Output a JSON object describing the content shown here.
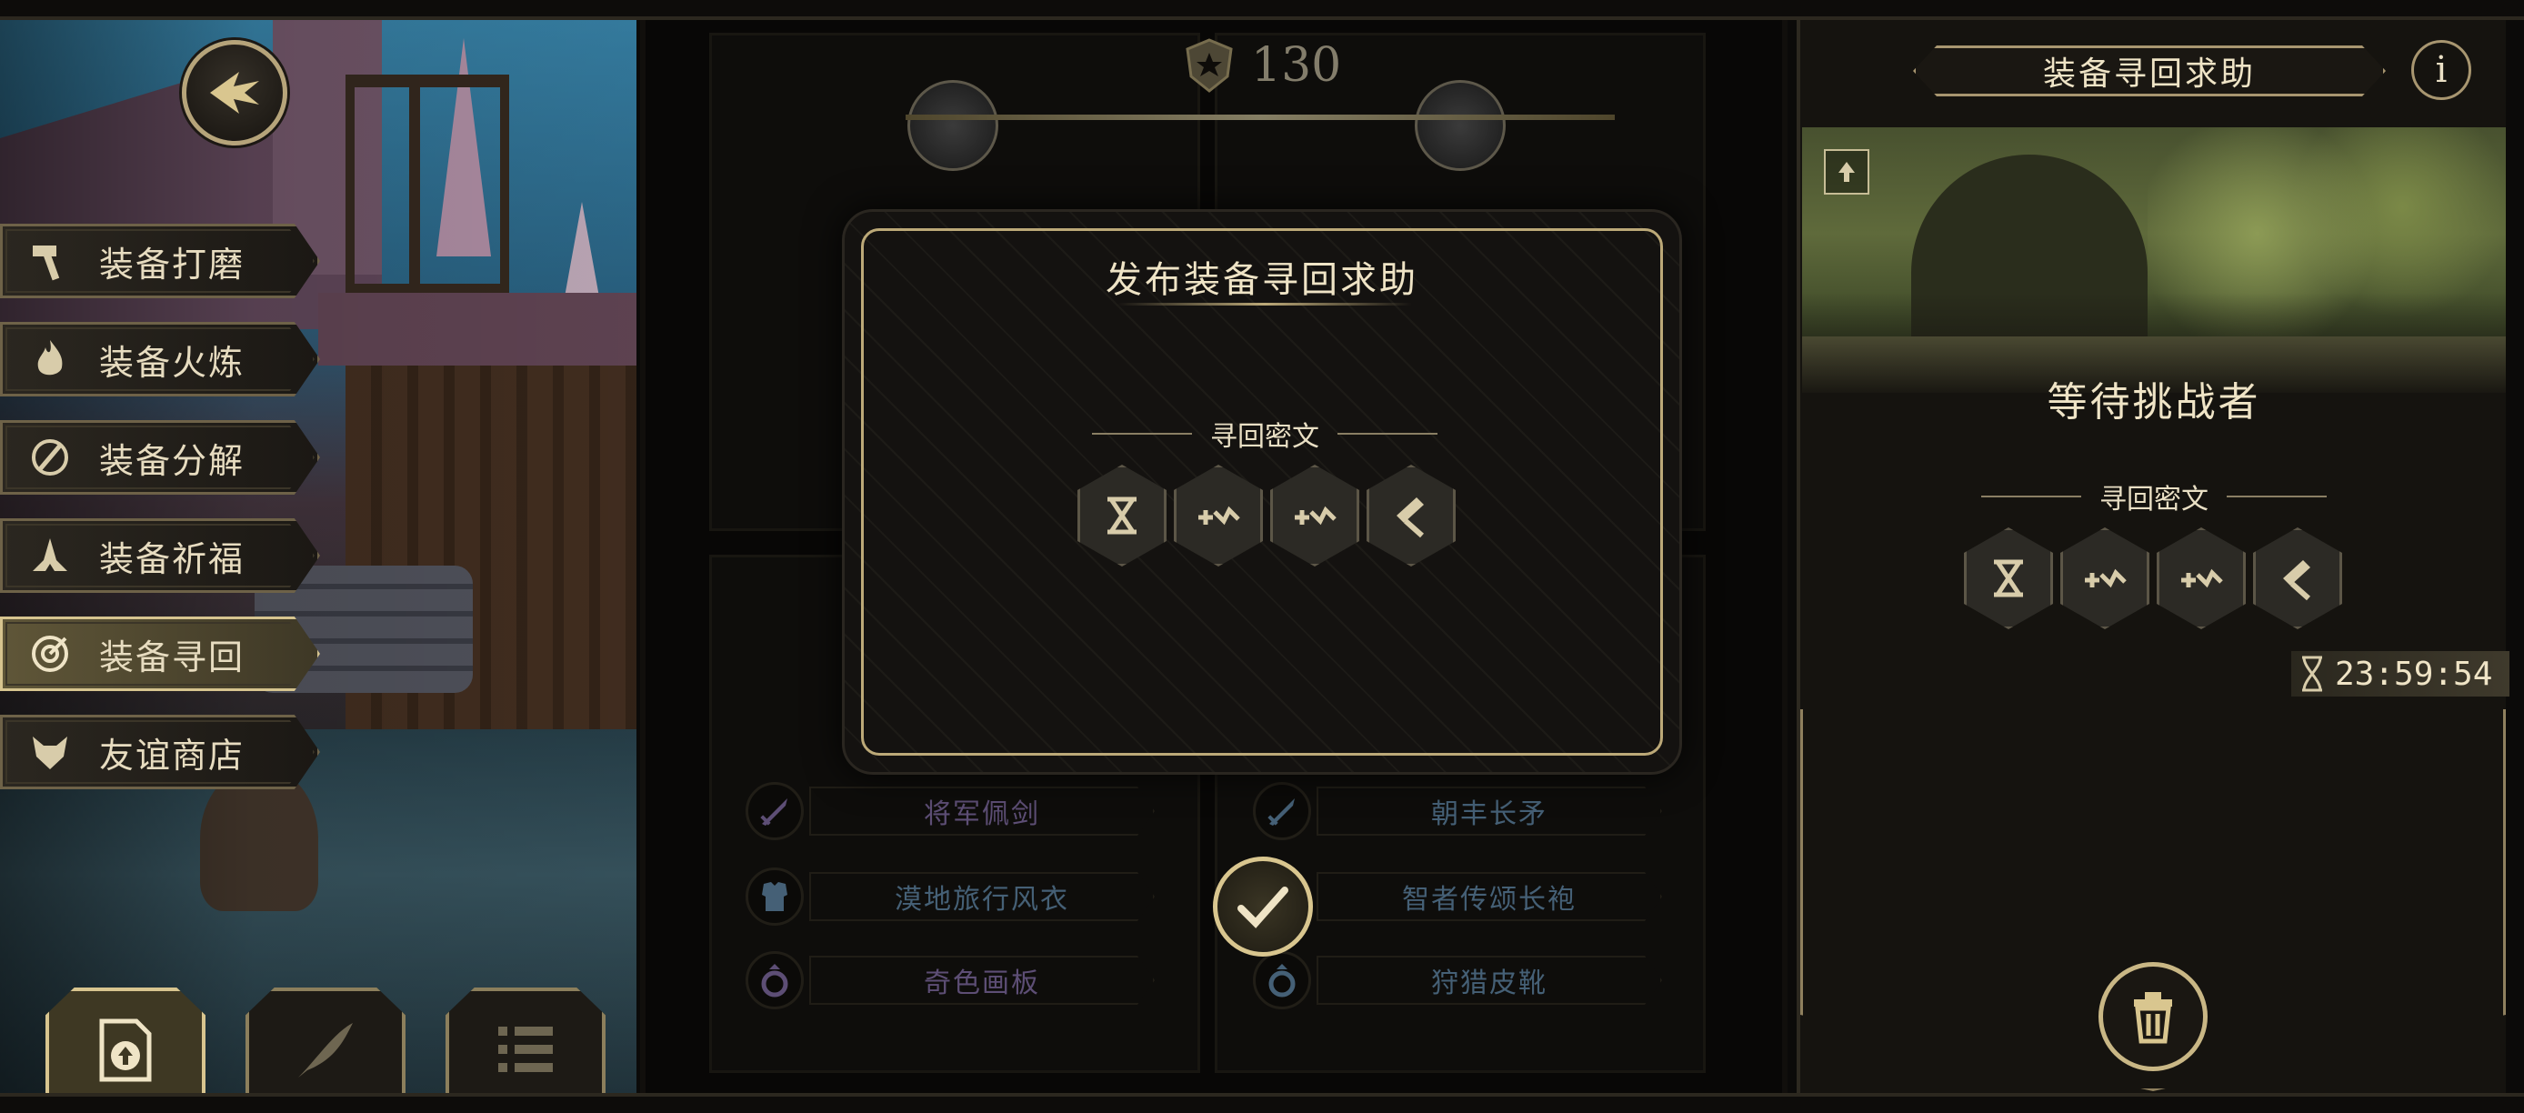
{
  "score": {
    "value": "130"
  },
  "menu": {
    "items": [
      {
        "label": "装备打磨",
        "icon": "hammer-icon"
      },
      {
        "label": "装备火炼",
        "icon": "flame-icon"
      },
      {
        "label": "装备分解",
        "icon": "disassemble-icon"
      },
      {
        "label": "装备祈福",
        "icon": "pray-hands-icon"
      },
      {
        "label": "装备寻回",
        "icon": "target-icon",
        "active": true
      },
      {
        "label": "友谊商店",
        "icon": "fox-icon"
      }
    ]
  },
  "equipment": {
    "left_bottom": [
      {
        "name": "将军佩剑",
        "icon": "sword-icon",
        "color": "#a98fd6"
      },
      {
        "name": "漠地旅行风衣",
        "icon": "armor-icon",
        "color": "#7fb0d8"
      },
      {
        "name": "奇色画板",
        "icon": "ring-icon",
        "color": "#a98fd6"
      }
    ],
    "right_bottom": [
      {
        "name": "朝丰长矛",
        "icon": "sword-icon",
        "color": "#7fb0d8"
      },
      {
        "name": "智者传颂长袍",
        "icon": "armor-icon",
        "color": "#7fb0d8"
      },
      {
        "name": "狩猎皮靴",
        "icon": "ring-icon",
        "color": "#7fb0d8"
      }
    ]
  },
  "modal": {
    "title": "发布装备寻回求助",
    "cipher_label": "寻回密文",
    "runes": [
      "rune-x-icon",
      "rune-plus-wave-icon",
      "rune-plus-wave-icon",
      "rune-hammer-icon"
    ]
  },
  "right_panel": {
    "title": "装备寻回求助",
    "info_label": "i",
    "status": "等待挑战者",
    "cipher_label": "寻回密文",
    "runes": [
      "rune-x-icon",
      "rune-plus-wave-icon",
      "rune-plus-wave-icon",
      "rune-hammer-icon"
    ],
    "timer": "23:59:54"
  },
  "colors": {
    "gold": "#d9c68f",
    "purple": "#a98fd6",
    "blue": "#7fb0d8",
    "bg": "#15130f"
  }
}
